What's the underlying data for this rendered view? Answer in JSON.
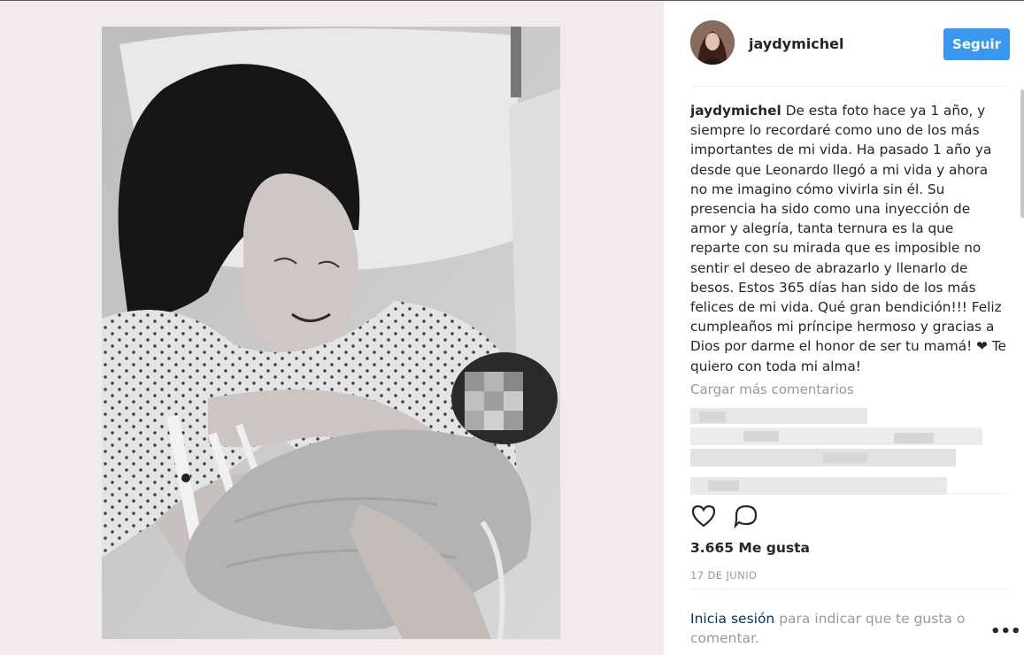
{
  "post": {
    "username": "jaydymichel",
    "follow_label": "Seguir",
    "caption_user": "jaydymichel",
    "caption_lines": [
      "De esta foto hace ya 1 año, y",
      "siempre lo recordaré como uno de los más",
      "importantes de mi vida. Ha pasado 1 año ya",
      "desde que Leonardo llegó a mi vida y ahora",
      "no me imagino cómo vivirla sin él. Su",
      "presencia ha sido como una inyección de",
      "amor y alegría, tanta ternura es la que",
      "reparte con su mirada que es imposible no",
      "sentir el deseo de abrazarlo y llenarlo de",
      "besos. Estos 365 días han sido de los más",
      "felices de mi vida. Qué gran bendición!!!",
      "Feliz cumpleaños mi príncipe hermoso y",
      "gracias a Dios por darme el honor de ser tu",
      "mamá! ❤ Te quiero con toda mi alma!"
    ],
    "load_more_label": "Cargar más comentarios",
    "likes": "3.665 Me gusta",
    "date": "17 DE JUNIO",
    "login_link": "Inicia sesión",
    "login_text": " para indicar que te gusta o comentar.",
    "more_options": "•••"
  },
  "icons": {
    "like": "heart-icon",
    "comment": "comment-icon"
  },
  "colors": {
    "follow_button": "#3897f0",
    "photo_background": "#f3ebeb",
    "login_link": "#003569",
    "muted_text": "#999999"
  }
}
